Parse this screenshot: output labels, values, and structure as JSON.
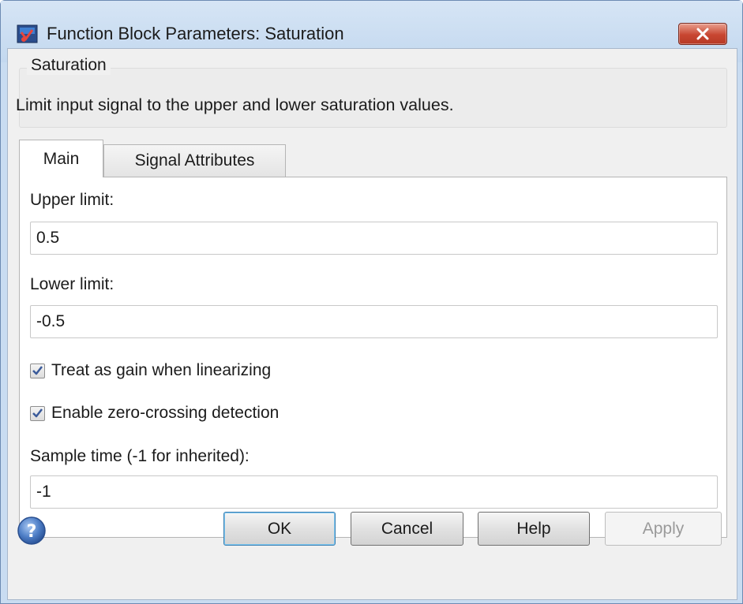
{
  "window": {
    "title": "Function Block Parameters: Saturation",
    "close_icon": "close-icon"
  },
  "description": {
    "group_title": "Saturation",
    "text": "Limit input signal to the upper and lower saturation values."
  },
  "tabs": [
    {
      "label": "Main",
      "selected": true
    },
    {
      "label": "Signal Attributes",
      "selected": false
    }
  ],
  "main": {
    "upper_limit": {
      "label": "Upper limit:",
      "value": "0.5"
    },
    "lower_limit": {
      "label": "Lower limit:",
      "value": "-0.5"
    },
    "treat_as_gain": {
      "label": "Treat as gain when linearizing",
      "checked": true
    },
    "zero_crossing": {
      "label": "Enable zero-crossing detection",
      "checked": true
    },
    "sample_time": {
      "label": "Sample time (-1 for inherited):",
      "value": "-1"
    }
  },
  "buttons": {
    "ok": "OK",
    "cancel": "Cancel",
    "help": "Help",
    "apply": "Apply"
  },
  "colors": {
    "titlebar": "#c9dcf1",
    "close_button": "#c84631",
    "dialog_background": "#f0f0f0",
    "default_button_border": "#3c7fb1"
  }
}
